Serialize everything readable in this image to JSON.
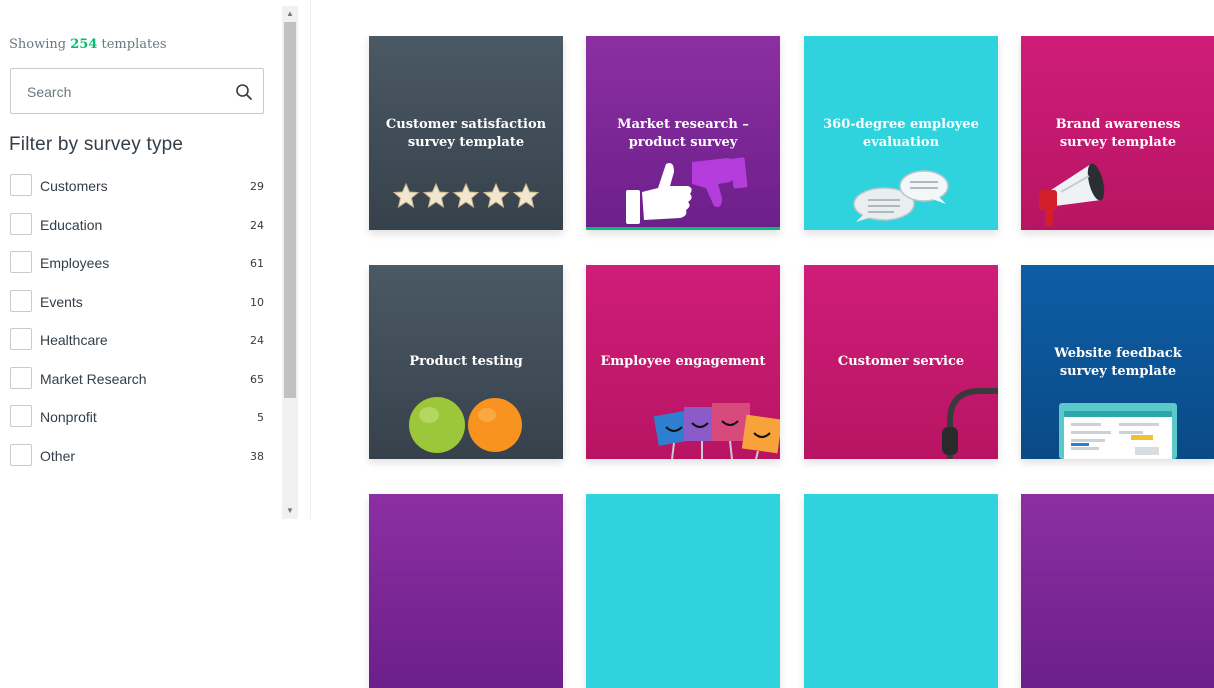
{
  "sidebar": {
    "showing_prefix": "Showing",
    "showing_count": "254",
    "showing_suffix": "templates",
    "search": {
      "placeholder": "Search",
      "value": ""
    },
    "filter_title": "Filter by survey type",
    "filters": [
      {
        "label": "Customers",
        "count": "29"
      },
      {
        "label": "Education",
        "count": "24"
      },
      {
        "label": "Employees",
        "count": "61"
      },
      {
        "label": "Events",
        "count": "10"
      },
      {
        "label": "Healthcare",
        "count": "24"
      },
      {
        "label": "Market Research",
        "count": "65"
      },
      {
        "label": "Nonprofit",
        "count": "5"
      },
      {
        "label": "Other",
        "count": "38"
      }
    ]
  },
  "cards": [
    {
      "title": "Customer satisfaction survey template",
      "color": "#3f4b56",
      "icon": "five-stars-icon"
    },
    {
      "title": "Market research – product survey",
      "color": "#7d27a0",
      "icon": "thumbs-up-down-icon"
    },
    {
      "title": "360-degree employee evaluation",
      "color": "#2fd3de",
      "icon": "speech-bubbles-icon"
    },
    {
      "title": "Brand awareness survey template",
      "color": "#c71a70",
      "icon": "megaphone-icon"
    },
    {
      "title": "Product testing",
      "color": "#3f4b56",
      "icon": "apple-orange-icon"
    },
    {
      "title": "Employee engagement",
      "color": "#c71a70",
      "icon": "happy-clips-icon"
    },
    {
      "title": "Customer service",
      "color": "#c71a70",
      "icon": "headset-icon"
    },
    {
      "title": "Website feedback survey template",
      "color": "#0a5396",
      "icon": "browser-window-icon"
    },
    {
      "title": "",
      "color": "#7d27a0",
      "icon": ""
    },
    {
      "title": "",
      "color": "#2fd3de",
      "icon": ""
    },
    {
      "title": "",
      "color": "#2fd3de",
      "icon": ""
    },
    {
      "title": "",
      "color": "#7d27a0",
      "icon": ""
    }
  ],
  "colors": {
    "accent_green": "#00bf6f"
  }
}
